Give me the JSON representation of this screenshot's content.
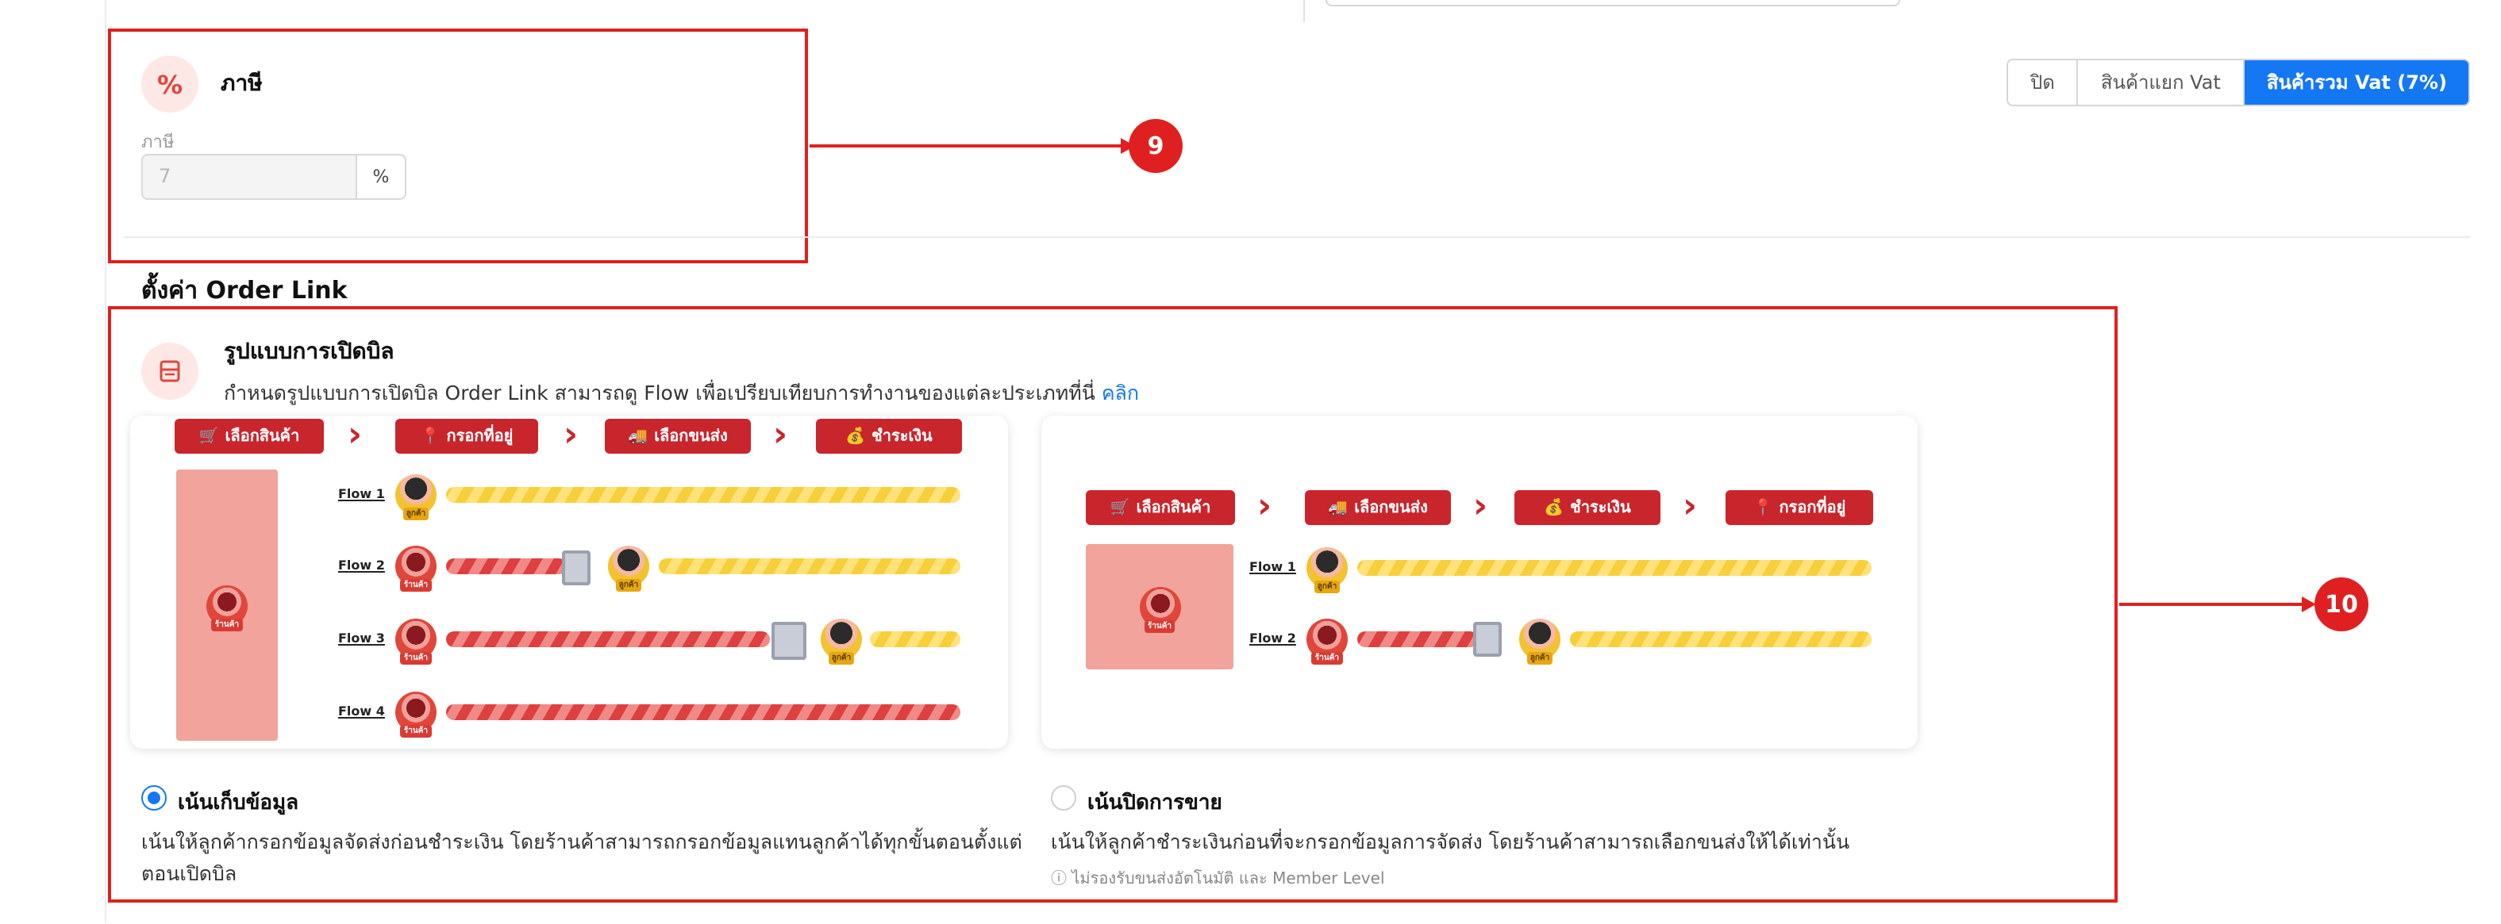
{
  "colors": {
    "accent_red": "#e02020",
    "brand_red": "#c9252c",
    "primary_blue": "#1478f5",
    "tint_red": "#fde8e6"
  },
  "tax": {
    "icon": "percent-icon",
    "icon_glyph": "%",
    "title": "ภาษี",
    "field_label": "ภาษี",
    "value": "7",
    "unit": "%",
    "modes": [
      {
        "label": "ปิด",
        "active": false
      },
      {
        "label": "สินค้าแยก Vat",
        "active": false
      },
      {
        "label": "สินค้ารวม Vat (7%)",
        "active": true
      }
    ]
  },
  "annotations": {
    "badge_tax": "9",
    "badge_order_link": "10"
  },
  "order_link": {
    "section_title": "ตั้งค่า Order Link",
    "icon": "receipt-icon",
    "title": "รูปแบบการเปิดบิล",
    "description": "กำหนดรูปแบบการเปิดบิล Order Link สามารถดู Flow เพื่อเปรียบเทียบการทำงานของแต่ละประเภทที่นี่",
    "link_text": "คลิก",
    "avatar_user_tag": "ลูกค้า",
    "avatar_store_tag": "ร้านค้า",
    "diagram1": {
      "steps": [
        {
          "label": "เลือกสินค้า",
          "icon": "cart-icon",
          "glyph": "🛒"
        },
        {
          "label": "กรอกที่อยู่",
          "icon": "location-pin-icon",
          "glyph": "📍"
        },
        {
          "label": "เลือกขนส่ง",
          "icon": "truck-icon",
          "glyph": "🚚"
        },
        {
          "label": "ชำระเงิน",
          "icon": "payment-icon",
          "glyph": "💰"
        }
      ],
      "flows": [
        "Flow 1",
        "Flow 2",
        "Flow 3",
        "Flow 4"
      ]
    },
    "diagram2": {
      "steps": [
        {
          "label": "เลือกสินค้า",
          "icon": "cart-icon",
          "glyph": "🛒"
        },
        {
          "label": "เลือกขนส่ง",
          "icon": "truck-icon",
          "glyph": "🚚"
        },
        {
          "label": "ชำระเงิน",
          "icon": "payment-icon",
          "glyph": "💰"
        },
        {
          "label": "กรอกที่อยู่",
          "icon": "location-pin-icon",
          "glyph": "📍"
        }
      ],
      "flows": [
        "Flow 1",
        "Flow 2"
      ]
    },
    "options": [
      {
        "title": "เน้นเก็บข้อมูล",
        "selected": true,
        "description": "เน้นให้ลูกค้ากรอกข้อมูลจัดส่งก่อนชำระเงิน โดยร้านค้าสามารถกรอกข้อมูลแทนลูกค้าได้ทุกขั้นตอนตั้งแต่ตอนเปิดบิล"
      },
      {
        "title": "เน้นปิดการขาย",
        "selected": false,
        "description": "เน้นให้ลูกค้าชำระเงินก่อนที่จะกรอกข้อมูลการจัดส่ง โดยร้านค้าสามารถเลือกขนส่งให้ได้เท่านั้น",
        "note": "ไม่รองรับขนส่งอัตโนมัติ และ Member Level"
      }
    ]
  }
}
